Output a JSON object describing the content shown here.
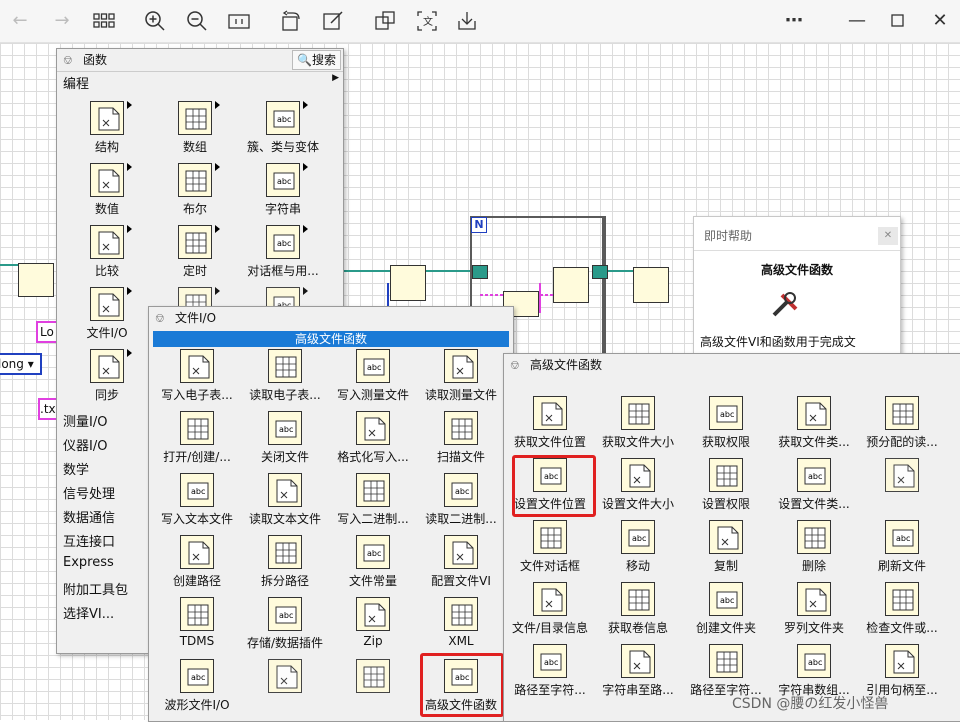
{
  "toolbar": {
    "icons": [
      "back-icon",
      "forward-icon",
      "grid-icon",
      "zoom-in-icon",
      "zoom-out-icon",
      "fit-icon",
      "rotate-icon",
      "edit-icon",
      "snip-icon",
      "translate-icon",
      "download-icon",
      "more-icon",
      "minimize-icon",
      "maximize-icon",
      "close-icon"
    ]
  },
  "functions_palette": {
    "title": "函数",
    "search_label": "搜索",
    "category": "编程",
    "items": [
      {
        "label": "结构"
      },
      {
        "label": "数组"
      },
      {
        "label": "簇、类与变体"
      },
      {
        "label": "数值"
      },
      {
        "label": "布尔"
      },
      {
        "label": "字符串"
      },
      {
        "label": "比较"
      },
      {
        "label": "定时"
      },
      {
        "label": "对话框与用..."
      },
      {
        "label": "文件I/O"
      },
      {
        "label": ""
      },
      {
        "label": ""
      },
      {
        "label": "同步"
      }
    ],
    "menu": [
      "测量I/O",
      "仪器I/O",
      "数学",
      "信号处理",
      "数据通信",
      "互连接口",
      "Express",
      "附加工具包",
      "选择VI..."
    ]
  },
  "fileio_palette": {
    "title": "文件I/O",
    "header": "高级文件函数",
    "items": [
      {
        "label": "写入电子表..."
      },
      {
        "label": "读取电子表..."
      },
      {
        "label": "写入测量文件"
      },
      {
        "label": "读取测量文件"
      },
      {
        "label": "打开/创建/..."
      },
      {
        "label": "关闭文件"
      },
      {
        "label": "格式化写入..."
      },
      {
        "label": "扫描文件"
      },
      {
        "label": "写入文本文件"
      },
      {
        "label": "读取文本文件"
      },
      {
        "label": "写入二进制..."
      },
      {
        "label": "读取二进制..."
      },
      {
        "label": "创建路径"
      },
      {
        "label": "拆分路径"
      },
      {
        "label": "文件常量"
      },
      {
        "label": "配置文件VI"
      },
      {
        "label": "TDMS"
      },
      {
        "label": "存储/数据插件"
      },
      {
        "label": "Zip"
      },
      {
        "label": "XML"
      },
      {
        "label": "波形文件I/O"
      },
      {
        "label": ""
      },
      {
        "label": ""
      },
      {
        "label": "高级文件函数"
      }
    ]
  },
  "advanced_palette": {
    "title": "高级文件函数",
    "items": [
      {
        "label": "获取文件位置"
      },
      {
        "label": "获取文件大小"
      },
      {
        "label": "获取权限"
      },
      {
        "label": "获取文件类..."
      },
      {
        "label": "预分配的读..."
      },
      {
        "label": "设置文件位置"
      },
      {
        "label": "设置文件大小"
      },
      {
        "label": "设置权限"
      },
      {
        "label": "设置文件类..."
      },
      {
        "label": ""
      },
      {
        "label": "文件对话框"
      },
      {
        "label": "移动"
      },
      {
        "label": "复制"
      },
      {
        "label": "删除"
      },
      {
        "label": "刷新文件"
      },
      {
        "label": "文件/目录信息"
      },
      {
        "label": "获取卷信息"
      },
      {
        "label": "创建文件夹"
      },
      {
        "label": "罗列文件夹"
      },
      {
        "label": "检查文件或..."
      },
      {
        "label": "路径至字符..."
      },
      {
        "label": "字符串至路..."
      },
      {
        "label": "路径至字符..."
      },
      {
        "label": "字符串数组..."
      },
      {
        "label": "引用句柄至..."
      }
    ]
  },
  "context_help": {
    "title": "即时帮助",
    "heading": "高级文件函数",
    "body": "高级文件VI和函数用于完成文"
  },
  "diagram": {
    "frame_label": "N",
    "ctrl_lo": "Lo",
    "ctrl_long": "long",
    "ctrl_tx": ".tx"
  },
  "watermark": "CSDN @腰の红发小怪兽",
  "colors": {
    "highlight_red": "#e02020",
    "header_blue": "#1a7ad6",
    "wire_teal": "#2a9a8a",
    "wire_pink": "#e040e0",
    "wire_blue": "#2040c0"
  }
}
